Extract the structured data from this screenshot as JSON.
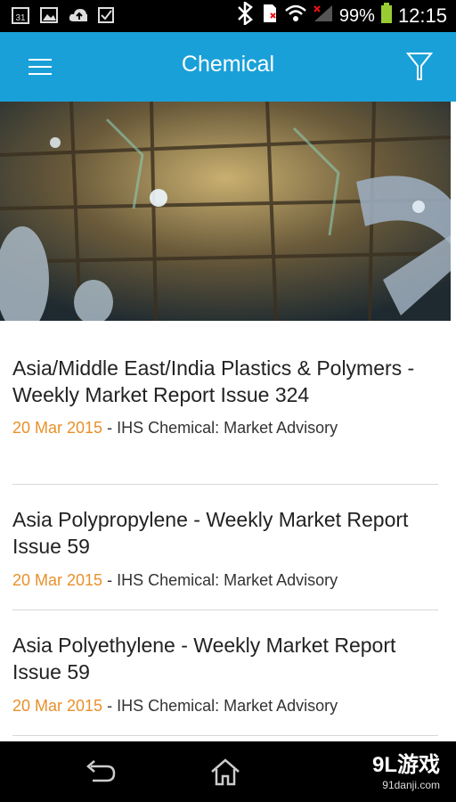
{
  "status_bar": {
    "calendar_day": "31",
    "battery": "99%",
    "time": "12:15",
    "icons": [
      "calendar-icon",
      "gallery-icon",
      "cloud-upload-icon",
      "checkbox-icon",
      "bluetooth-icon",
      "sd-card-icon",
      "wifi-icon",
      "signal-icon",
      "battery-icon"
    ]
  },
  "app_bar": {
    "title": "Chemical",
    "menu_icon": "hamburger-icon",
    "filter_icon": "filter-icon",
    "color": "#1aa0d8"
  },
  "hero": {
    "image": "industrial-plant-photo"
  },
  "articles": [
    {
      "title": "Asia/Middle East/India Plastics & Polymers - Weekly Market Report Issue 324",
      "date": "20 Mar 2015",
      "separator": " - ",
      "source": "IHS Chemical: Market Advisory"
    },
    {
      "title": "Asia Polypropylene - Weekly Market Report Issue 59",
      "date": "20 Mar 2015",
      "separator": " - ",
      "source": "IHS Chemical: Market Advisory"
    },
    {
      "title": "Asia Polyethylene - Weekly Market Report Issue 59",
      "date": "20 Mar 2015",
      "separator": " - ",
      "source": "IHS Chemical: Market Advisory"
    }
  ],
  "date_color": "#e8902a",
  "nav_bar": {
    "icons": [
      "back-icon",
      "home-icon"
    ]
  },
  "watermark": {
    "text": "9L游戏",
    "url": "91danji.com"
  }
}
